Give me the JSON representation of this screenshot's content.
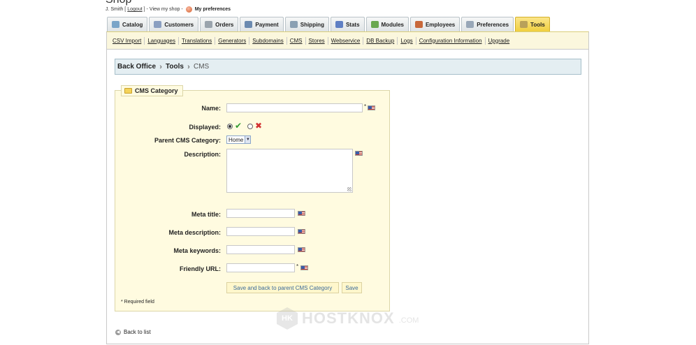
{
  "header": {
    "shop_title": "Shop",
    "user_name": "J. Smith",
    "logout": "Logout",
    "view_shop": "View my shop",
    "preferences": "My preferences"
  },
  "tabs": [
    {
      "label": "Catalog",
      "color": "#7aa5c8"
    },
    {
      "label": "Customers",
      "color": "#8a9fc1"
    },
    {
      "label": "Orders",
      "color": "#9aa4ad"
    },
    {
      "label": "Payment",
      "color": "#6b8ab0"
    },
    {
      "label": "Shipping",
      "color": "#8aa0b3"
    },
    {
      "label": "Stats",
      "color": "#5f7fc4"
    },
    {
      "label": "Modules",
      "color": "#6aa84f"
    },
    {
      "label": "Employees",
      "color": "#c8683a"
    },
    {
      "label": "Preferences",
      "color": "#98a7b8"
    },
    {
      "label": "Tools",
      "color": "#b9a15a"
    }
  ],
  "subnav": [
    "CSV Import",
    "Languages",
    "Translations",
    "Generators",
    "Subdomains",
    "CMS",
    "Stores",
    "Webservice",
    "DB Backup",
    "Logs",
    "Configuration Information",
    "Upgrade"
  ],
  "breadcrumb": {
    "root": "Back Office",
    "section": "Tools",
    "current": "CMS"
  },
  "form": {
    "legend": "CMS Category",
    "name_label": "Name:",
    "name_value": "",
    "displayed_label": "Displayed:",
    "parent_label": "Parent CMS Category:",
    "parent_value": "Home",
    "description_label": "Description:",
    "meta_title_label": "Meta title:",
    "meta_description_label": "Meta description:",
    "meta_keywords_label": "Meta keywords:",
    "friendly_url_label": "Friendly URL:",
    "required_marker": "*",
    "save_back_button": "Save and back to parent CMS Category",
    "save_button": "Save",
    "required_note": "* Required field"
  },
  "back_link": "Back to list",
  "watermark": {
    "logo": "HK",
    "text": "HOSTKNOX",
    "domain": ".COM"
  }
}
